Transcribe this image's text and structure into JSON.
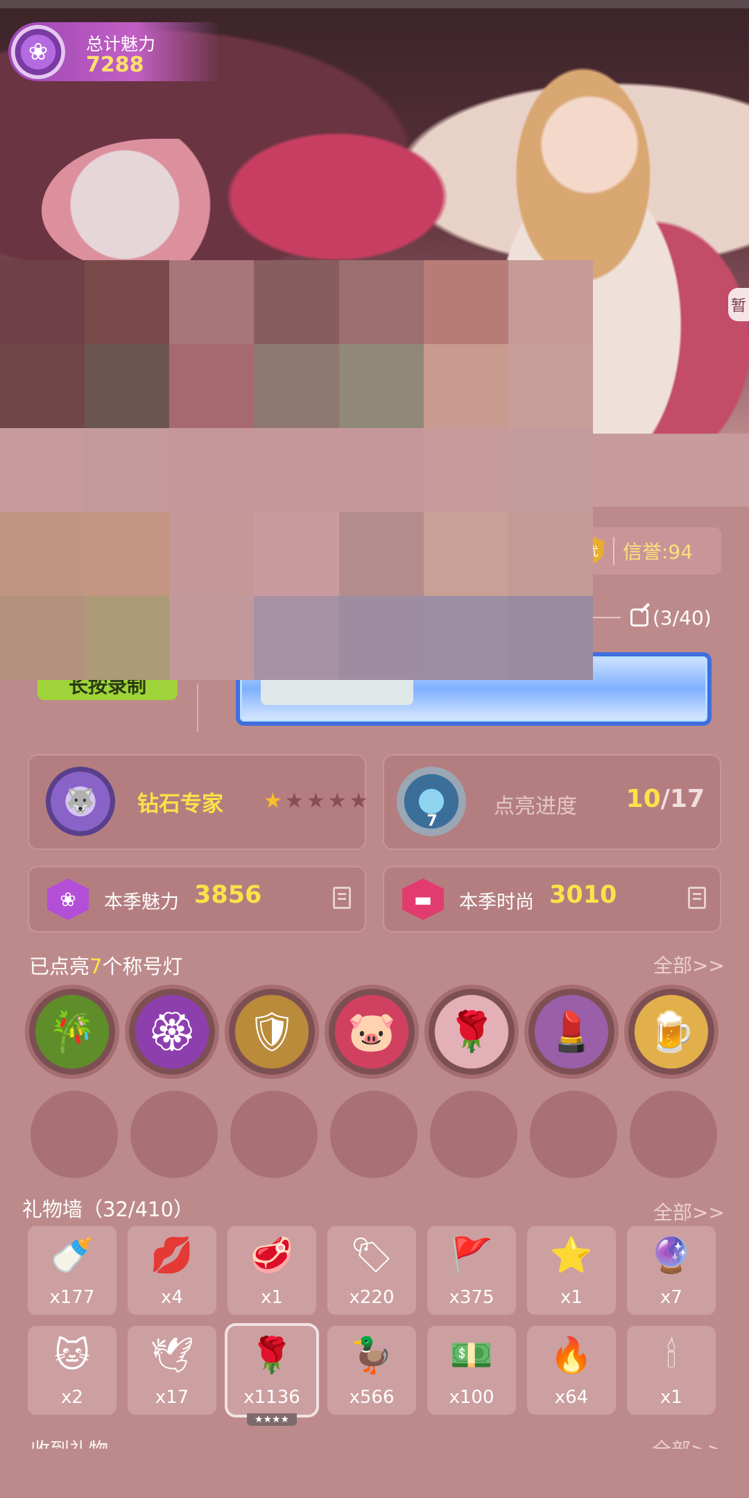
{
  "header": {
    "charm_label": "总计魅力",
    "charm_value": "7288",
    "side_tag": "暂"
  },
  "profile": {
    "credit_icon_text": "优",
    "credit_label": "信誉:94",
    "message_count": "(3/40)",
    "record_button": "长按录制"
  },
  "rank": {
    "title": "钻石专家",
    "stars_total": 5,
    "stars_lit": 1,
    "star_glyph": "★"
  },
  "light": {
    "label": "点亮进度",
    "level": "7",
    "current": "10",
    "total": "/17"
  },
  "season": {
    "charm_label": "本季魅力",
    "charm_value": "3856",
    "fashion_label": "本季时尚",
    "fashion_value": "3010"
  },
  "titles_section": {
    "prefix": "已点亮",
    "count": "7",
    "suffix": "个称号灯",
    "all_link": "全部>>",
    "icons": [
      {
        "name": "bamboo-scroll-icon",
        "glyph": "🎋"
      },
      {
        "name": "purple-flower-badge-icon",
        "glyph": "🏵"
      },
      {
        "name": "shield-sword-icon",
        "glyph": "🛡"
      },
      {
        "name": "pig-dumplings-icon",
        "glyph": "🐷"
      },
      {
        "name": "white-rose-icon",
        "glyph": "🌹"
      },
      {
        "name": "lipstick-icon",
        "glyph": "💄"
      },
      {
        "name": "beer-party-icon",
        "glyph": "🍺"
      }
    ]
  },
  "gift_wall": {
    "title": "礼物墙（32/410）",
    "all_link": "全部>>",
    "gifts": [
      {
        "name": "milk-bottle-icon",
        "glyph": "🍼",
        "count": "x177"
      },
      {
        "name": "lips-icon",
        "glyph": "💋",
        "count": "x4"
      },
      {
        "name": "meat-roll-icon",
        "glyph": "🥩",
        "count": "x1"
      },
      {
        "name": "tag-icon",
        "glyph": "🏷",
        "count": "x220"
      },
      {
        "name": "pennant-icon",
        "glyph": "🚩",
        "count": "x375"
      },
      {
        "name": "star-wand-icon",
        "glyph": "⭐",
        "count": "x1"
      },
      {
        "name": "crystal-icon",
        "glyph": "🔮",
        "count": "x7"
      },
      {
        "name": "cat-face-icon",
        "glyph": "🐱",
        "count": "x2"
      },
      {
        "name": "paper-crane-icon",
        "glyph": "🕊",
        "count": "x17"
      },
      {
        "name": "red-rose-icon",
        "glyph": "🌹",
        "count": "x1136"
      },
      {
        "name": "golden-duck-icon",
        "glyph": "🦆",
        "count": "x566"
      },
      {
        "name": "money-note-icon",
        "glyph": "💵",
        "count": "x100"
      },
      {
        "name": "blue-flame-icon",
        "glyph": "🔥",
        "count": "x64"
      },
      {
        "name": "candelabra-icon",
        "glyph": "🕯",
        "count": "x1"
      }
    ],
    "selected_rating": "★★★★"
  },
  "received": {
    "title": "收到礼物",
    "all_link": "全部>>"
  },
  "colors": {
    "background": "#bd8a8b",
    "highlight": "#ffe14a",
    "mosaic": [
      "#6e4047",
      "#7a4a4a",
      "#a8757a",
      "#875d60",
      "#9b6e70",
      "#b87c76",
      "#c69a97",
      "#704649",
      "#6b5552",
      "#a6696f",
      "#8f7870",
      "#908878",
      "#c99a8f",
      "#c79e99",
      "#c79a9d",
      "#c4999c",
      "#c4969a",
      "#c4979b",
      "#c5979a",
      "#c79b9c",
      "#c39c9f",
      "#c09582",
      "#c39582",
      "#c49799",
      "#c99b9e",
      "#b38c8e",
      "#c9a096",
      "#c39a96",
      "#b3917e",
      "#ad9a77",
      "#c3989b",
      "#a692a3",
      "#9e8ca1",
      "#9c8ea3",
      "#9a8aa0"
    ]
  }
}
